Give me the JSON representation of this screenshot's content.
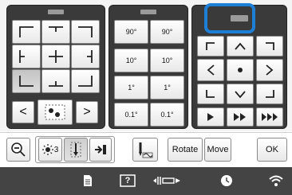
{
  "panel1": {
    "alignment_buttons": [
      "top-left",
      "top-center",
      "top-right",
      "middle-left",
      "center",
      "middle-right",
      "bottom-left",
      "bottom-center",
      "bottom-right"
    ],
    "nav_prev": "<",
    "nav_next": ">"
  },
  "panel2": {
    "rotate_buttons": [
      {
        "label": "90°"
      },
      {
        "label": "90°"
      },
      {
        "label": "10°"
      },
      {
        "label": "10°"
      },
      {
        "label": "1°"
      },
      {
        "label": "1°"
      },
      {
        "label": "0.1°"
      },
      {
        "label": "0.1°"
      }
    ]
  },
  "panel3": {
    "move_arrows": [
      "up",
      "left",
      "center",
      "right",
      "down"
    ],
    "playback": [
      "play",
      "fast-forward",
      "faster-forward"
    ]
  },
  "toolbar": {
    "zoom_icon": "magnifier-minus-icon",
    "brightness_label": "3",
    "rotate_label": "Rotate",
    "move_label": "Move",
    "ok_label": "OK"
  },
  "status": {
    "icons": [
      "document-icon",
      "help-icon",
      "needle-position-icon",
      "clock-icon",
      "wifi-icon"
    ],
    "help_text": "?"
  },
  "colors": {
    "panel_bg": "#3a3a3a",
    "highlight": "#1e7fd6",
    "status_bg": "#444444"
  }
}
